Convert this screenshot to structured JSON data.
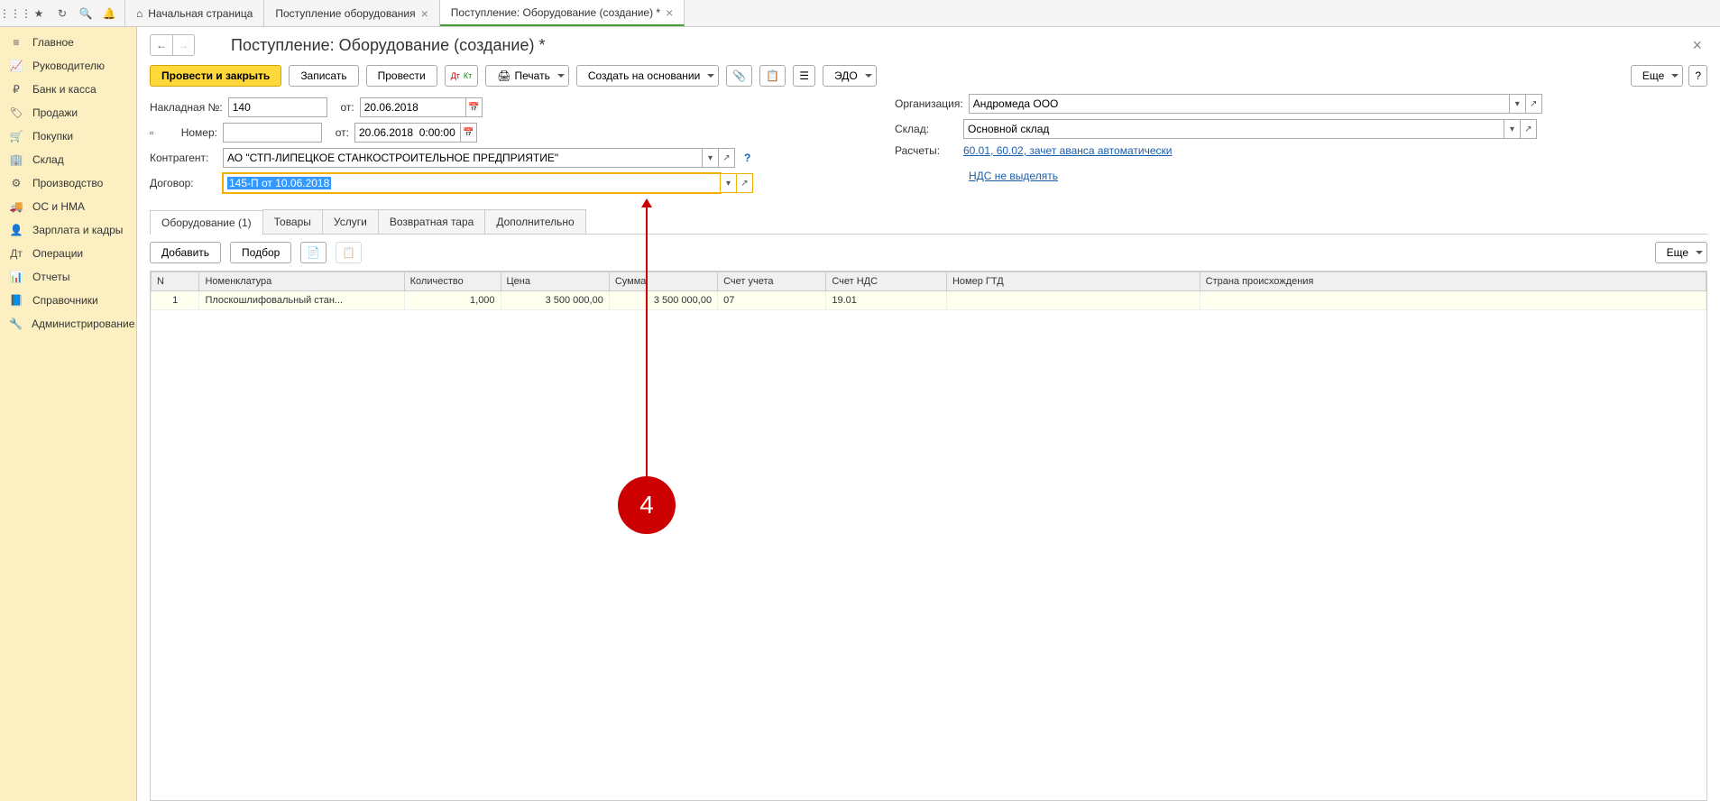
{
  "topTabs": [
    {
      "label": "Начальная страница",
      "closable": false,
      "active": false,
      "home": true
    },
    {
      "label": "Поступление оборудования",
      "closable": true,
      "active": false
    },
    {
      "label": "Поступление: Оборудование (создание) *",
      "closable": true,
      "active": true
    }
  ],
  "sidebar": {
    "items": [
      {
        "label": "Главное",
        "icon": "≡"
      },
      {
        "label": "Руководителю",
        "icon": "📈"
      },
      {
        "label": "Банк и касса",
        "icon": "₽"
      },
      {
        "label": "Продажи",
        "icon": "🏷"
      },
      {
        "label": "Покупки",
        "icon": "🛒"
      },
      {
        "label": "Склад",
        "icon": "🏢"
      },
      {
        "label": "Производство",
        "icon": "⚙"
      },
      {
        "label": "ОС и НМА",
        "icon": "🚚"
      },
      {
        "label": "Зарплата и кадры",
        "icon": "👤"
      },
      {
        "label": "Операции",
        "icon": "Дт"
      },
      {
        "label": "Отчеты",
        "icon": "📊"
      },
      {
        "label": "Справочники",
        "icon": "📘"
      },
      {
        "label": "Администрирование",
        "icon": "🔧"
      }
    ]
  },
  "page": {
    "title": "Поступление: Оборудование (создание) *"
  },
  "toolbar": {
    "post_close": "Провести и закрыть",
    "save": "Записать",
    "post": "Провести",
    "print": "Печать",
    "create_basis": "Создать на основании",
    "edo": "ЭДО",
    "more": "Еще",
    "help": "?"
  },
  "form": {
    "invoice_no_label": "Накладная №:",
    "invoice_no": "140",
    "from_label": "от:",
    "invoice_date": "20.06.2018",
    "number_label": "Номер:",
    "number": "",
    "number_date": "20.06.2018  0:00:00",
    "counterparty_label": "Контрагент:",
    "counterparty": "АО \"СТП-ЛИПЕЦКОЕ СТАНКОСТРОИТЕЛЬНОЕ ПРЕДПРИЯТИЕ\"",
    "contract_label": "Договор:",
    "contract": "145-П от 10.06.2018",
    "org_label": "Организация:",
    "org": "Андромеда ООО",
    "warehouse_label": "Склад:",
    "warehouse": "Основной склад",
    "settlements_label": "Расчеты:",
    "settlements_link": "60.01, 60.02, зачет аванса автоматически",
    "vat_link": "НДС не выделять"
  },
  "subtabs": [
    "Оборудование (1)",
    "Товары",
    "Услуги",
    "Возвратная тара",
    "Дополнительно"
  ],
  "subtoolbar": {
    "add": "Добавить",
    "select": "Подбор",
    "more": "Еще"
  },
  "table": {
    "headers": [
      "N",
      "Номенклатура",
      "Количество",
      "Цена",
      "Сумма",
      "Счет учета",
      "Счет НДС",
      "Номер ГТД",
      "Страна происхождения"
    ],
    "rows": [
      {
        "n": "1",
        "nomen": "Плоскошлифовальный стан...",
        "qty": "1,000",
        "price": "3 500 000,00",
        "sum": "3 500 000,00",
        "acct": "07",
        "vat_acct": "19.01",
        "gtd": "",
        "country": ""
      }
    ]
  },
  "annotation": {
    "number": "4"
  }
}
